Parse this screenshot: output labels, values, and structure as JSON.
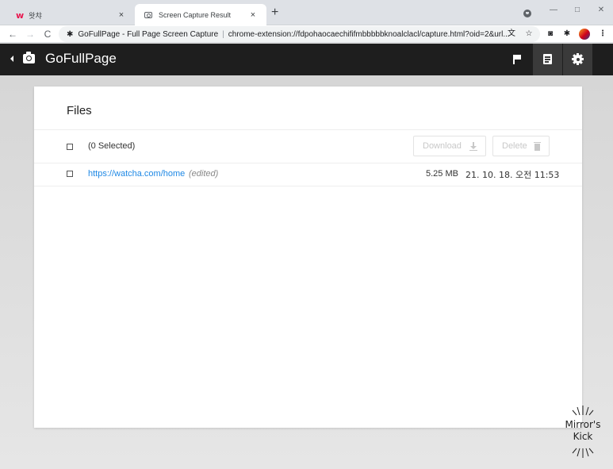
{
  "browser": {
    "tabs": [
      {
        "title": "왓챠",
        "close": "×"
      },
      {
        "title": "Screen Capture Result",
        "close": "×"
      }
    ],
    "new_tab": "+",
    "window_controls": {
      "minimize": "—",
      "maximize": "□",
      "close": "✕"
    },
    "nav": {
      "back": "←",
      "forward": "→",
      "reload": "C"
    },
    "address": {
      "site": "GoFullPage - Full Page Screen Capture",
      "separator": "|",
      "url": "chrome-extension://fdpohaocaechififmbbbbbknoalclacl/capture.html?oid=2&url..."
    },
    "toolbar_icons": [
      "translate-icon",
      "star-icon",
      "camera-icon",
      "puzzle-icon",
      "avatar"
    ]
  },
  "app": {
    "title": "GoFullPage",
    "header_buttons": [
      "flag-icon",
      "document-icon",
      "gear-icon"
    ]
  },
  "files": {
    "heading": "Files",
    "selected_label": "(0 Selected)",
    "download_label": "Download",
    "delete_label": "Delete",
    "items": [
      {
        "url": "https://watcha.com/home",
        "note": "(edited)",
        "size": "5.25 MB",
        "date": "21. 10. 18. 오전 11:53"
      }
    ]
  },
  "watermark": {
    "line1": "Mirror's",
    "line2": "Kick"
  },
  "colors": {
    "appbar": "#1e1e1e",
    "link": "#1e88e5",
    "brand_w": "#e8174f"
  }
}
